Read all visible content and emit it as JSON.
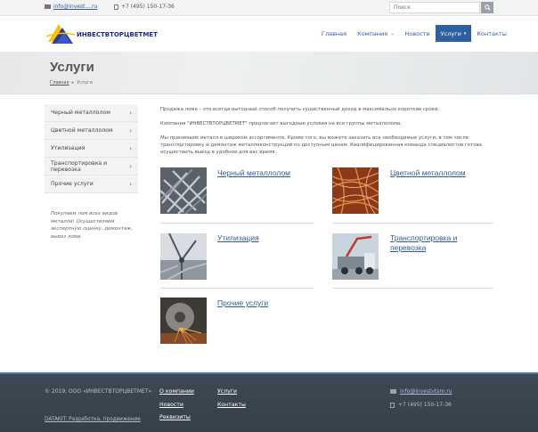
{
  "topbar": {
    "email": "info@invest....ru",
    "phone": "+7 (495) 150-17-36",
    "search_placeholder": "Поиск"
  },
  "header": {
    "logo_text": "ИНВЕСТВТОРЦВЕТМЕТ",
    "nav": [
      {
        "label": "Главная"
      },
      {
        "label": "Компания",
        "has_dropdown": true
      },
      {
        "label": "Новости"
      },
      {
        "label": "Услуги",
        "has_dropdown": true,
        "active": true
      },
      {
        "label": "Контакты"
      }
    ]
  },
  "banner": {
    "title": "Услуги",
    "breadcrumb": [
      "Главная",
      "Услуги"
    ]
  },
  "sidebar": {
    "items": [
      {
        "label": "Черный металлолом"
      },
      {
        "label": "Цветной металлолом"
      },
      {
        "label": "Утилизация"
      },
      {
        "label": "Транспортировка и перевозка"
      },
      {
        "label": "Прочие услуги"
      }
    ],
    "note": "Покупаем лом всех видов металла! Осуществляем экспертную оценку, демонтаж, вывоз лома."
  },
  "content": {
    "paragraphs": [
      "Продажа лома – это всегда выгодный способ получить существенный доход в максимально короткие сроки.",
      "Компания \"ИНВЕСТВТОРЦВЕТМЕТ\" предлагает выгодные условия на все группы металлолома.",
      "Мы принимаем металл в широком ассортименте. Кроме того, вы можете заказать все необходимые услуги, в том числе транспортировку и демонтаж металлоконструкций по доступным ценам. Квалифицированная команда специалистов готова осуществить выезд в удобное для вас время."
    ],
    "services": [
      {
        "label": "Черный металлолом",
        "image": "scrap-steel-image"
      },
      {
        "label": "Цветной металлолом",
        "image": "copper-wire-image"
      },
      {
        "label": "Утилизация",
        "image": "recycling-image"
      },
      {
        "label": "Транспортировка и перевозка",
        "image": "truck-crane-image"
      },
      {
        "label": "Прочие услуги",
        "image": "metal-cutting-image"
      }
    ]
  },
  "footer": {
    "copyright": "© 2019, ООО «ИНВЕСТВТОРЦВЕТМЕТ»",
    "developer": "DATAKIT: Разработка, продвижение",
    "links_col1": [
      "О компании",
      "Новости",
      "Реквизиты"
    ],
    "links_col2": [
      "Услуги",
      "Контакты"
    ],
    "email": "info@investvtsm.ru",
    "phone": "+7 (495) 150-17-36"
  },
  "colors": {
    "accent": "#2e5f9e",
    "link": "#2f5d9a",
    "footer_bg": "#3a4550"
  }
}
